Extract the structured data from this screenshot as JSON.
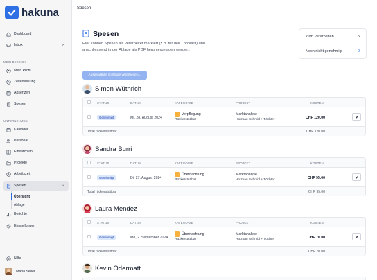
{
  "app": {
    "name": "hakuna"
  },
  "topbar": {
    "title": "Spesen"
  },
  "sidebar": {
    "main_items": [
      {
        "label": "Dashboard",
        "icon": "home-icon"
      },
      {
        "label": "Inbox",
        "icon": "inbox-icon"
      }
    ],
    "section_mine": "MEIN BEREICH",
    "mine_items": [
      {
        "label": "Mein Profil",
        "icon": "user-icon"
      },
      {
        "label": "Zeiterfassung",
        "icon": "clock-icon"
      },
      {
        "label": "Absenzen",
        "icon": "calendar-icon"
      },
      {
        "label": "Spesen",
        "icon": "receipt-icon"
      }
    ],
    "section_company": "UNTERNEHMEN",
    "company_items": [
      {
        "label": "Kalender",
        "icon": "calendar-icon"
      },
      {
        "label": "Personal",
        "icon": "users-icon"
      },
      {
        "label": "Einsatzplan",
        "icon": "grid-icon"
      },
      {
        "label": "Projekte",
        "icon": "folder-icon"
      },
      {
        "label": "Arbeitszeit",
        "icon": "clock-icon"
      },
      {
        "label": "Spesen",
        "icon": "receipt-icon"
      }
    ],
    "sub_items": [
      {
        "label": "Übersicht"
      },
      {
        "label": "Ablage"
      }
    ],
    "more_items": [
      {
        "label": "Berichte",
        "icon": "chart-icon"
      },
      {
        "label": "Einstellungen",
        "icon": "gear-icon"
      }
    ],
    "help": "Hilfe",
    "user": "Maria Seiler"
  },
  "page": {
    "title": "Spesen",
    "description": "Hier können Spesen als verarbeitet markiert (z.B. für den Lohnlauf) und anschliessend in der Ablage als PDF heruntergeladen werden.",
    "bulk_button": "Ausgewählte Einträge verarbeiten..."
  },
  "stats": {
    "to_process_label": "Zum Verarbeiten",
    "to_process_value": "5",
    "not_approved_label": "Noch nicht genehmigt",
    "not_approved_value": "0"
  },
  "table_headers": {
    "status": "STATUS",
    "date": "DATUM",
    "category": "KATEGORIE",
    "project": "PROJEKT",
    "cost": "KOSTEN"
  },
  "persons": [
    {
      "name": "Simon Wüthrich",
      "status": "Genehmigt",
      "date": "Mi, 28. August 2024",
      "category": "Verpflegung",
      "category_sub": "Rückerstattbar",
      "project": "Marktanalyse",
      "project_sub": "Holzbau Schmid + Töchter",
      "amount": "CHF 120.00",
      "total_label": "Total rückerstattbar",
      "total": "CHF 120.00"
    },
    {
      "name": "Sandra Burri",
      "status": "Genehmigt",
      "date": "Di, 27. August 2024",
      "category": "Übernachtung",
      "category_sub": "Rückerstattbar",
      "project": "Marktanalyse",
      "project_sub": "Holzbau Schmid + Töchter",
      "amount": "CHF 95.00",
      "total_label": "Total rückerstattbar",
      "total": "CHF 95.00"
    },
    {
      "name": "Laura Mendez",
      "status": "Genehmigt",
      "date": "Mo, 2. September 2024",
      "category": "Übernachtung",
      "category_sub": "Rückerstattbar",
      "project": "Marktanalyse",
      "project_sub": "Holzbau Schmid + Töchter",
      "amount": "CHF 70.00",
      "total_label": "Total rückerstattbar",
      "total": "CHF 70.00"
    },
    {
      "name": "Kevin Odermatt"
    }
  ],
  "colors": {
    "accent": "#2f6fe4",
    "badge_bg": "#dbe7fb",
    "category_icon": "#f6b23c"
  }
}
